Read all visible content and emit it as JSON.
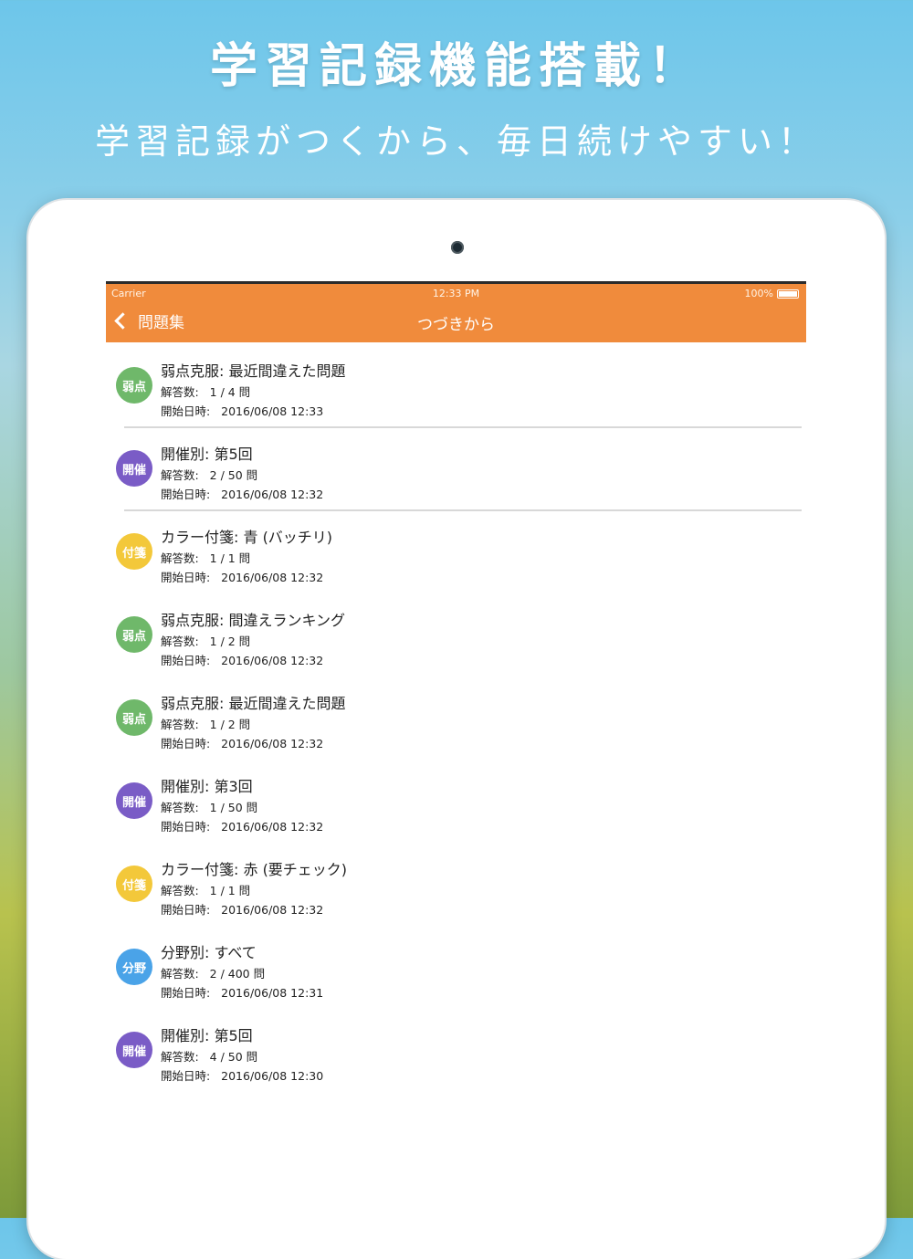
{
  "hero": {
    "title": "学習記録機能搭載！",
    "subtitle": "学習記録がつくから、毎日続けやすい！"
  },
  "status_bar": {
    "carrier": "Carrier",
    "time": "12:33 PM",
    "battery": "100%"
  },
  "nav": {
    "back_label": "問題集",
    "title": "つづきから"
  },
  "colors": {
    "nav": "#f08b3c",
    "green": "#6fb86a",
    "purple": "#7a5cc6",
    "yellow": "#f3c83a",
    "blue": "#4aa3e8"
  },
  "records": [
    {
      "badge": "弱点",
      "badge_color": "#6fb86a",
      "title": "弱点克服: 最近間違えた問題",
      "answered_label": "解答数:",
      "answered": "1 / 4 問",
      "start_label": "開始日時:",
      "start": "2016/06/08 12:33",
      "divider": true
    },
    {
      "badge": "開催",
      "badge_color": "#7a5cc6",
      "title": "開催別: 第5回",
      "answered_label": "解答数:",
      "answered": "2 / 50 問",
      "start_label": "開始日時:",
      "start": "2016/06/08 12:32",
      "divider": true
    },
    {
      "badge": "付箋",
      "badge_color": "#f3c83a",
      "title": "カラー付箋: 青 (バッチリ)",
      "answered_label": "解答数:",
      "answered": "1 / 1 問",
      "start_label": "開始日時:",
      "start": "2016/06/08 12:32",
      "divider": false
    },
    {
      "badge": "弱点",
      "badge_color": "#6fb86a",
      "title": "弱点克服: 間違えランキング",
      "answered_label": "解答数:",
      "answered": "1 / 2 問",
      "start_label": "開始日時:",
      "start": "2016/06/08 12:32",
      "divider": false
    },
    {
      "badge": "弱点",
      "badge_color": "#6fb86a",
      "title": "弱点克服: 最近間違えた問題",
      "answered_label": "解答数:",
      "answered": "1 / 2 問",
      "start_label": "開始日時:",
      "start": "2016/06/08 12:32",
      "divider": false
    },
    {
      "badge": "開催",
      "badge_color": "#7a5cc6",
      "title": "開催別: 第3回",
      "answered_label": "解答数:",
      "answered": "1 / 50 問",
      "start_label": "開始日時:",
      "start": "2016/06/08 12:32",
      "divider": false
    },
    {
      "badge": "付箋",
      "badge_color": "#f3c83a",
      "title": "カラー付箋: 赤 (要チェック)",
      "answered_label": "解答数:",
      "answered": "1 / 1 問",
      "start_label": "開始日時:",
      "start": "2016/06/08 12:32",
      "divider": false
    },
    {
      "badge": "分野",
      "badge_color": "#4aa3e8",
      "title": "分野別: すべて",
      "answered_label": "解答数:",
      "answered": "2 / 400 問",
      "start_label": "開始日時:",
      "start": "2016/06/08 12:31",
      "divider": false
    },
    {
      "badge": "開催",
      "badge_color": "#7a5cc6",
      "title": "開催別: 第5回",
      "answered_label": "解答数:",
      "answered": "4 / 50 問",
      "start_label": "開始日時:",
      "start": "2016/06/08 12:30",
      "divider": false
    }
  ]
}
